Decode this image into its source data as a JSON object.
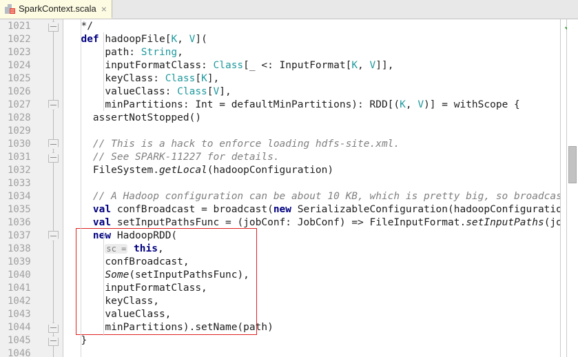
{
  "tab": {
    "title": "SparkContext.scala",
    "close_label": "×",
    "icon": "scala-file-icon"
  },
  "editor": {
    "first_line": 1021,
    "line_height": 19,
    "status_icon": "green-check-icon",
    "accent_highlight_color": "#e02020",
    "keyword_color": "#000080",
    "type_color": "#20999d",
    "comment_color": "#808080",
    "gutter_color": "#f0f0f0",
    "line_number_color": "#a0a0a0",
    "lines": [
      {
        "n": 1021,
        "indent": 4,
        "tokens": [
          {
            "t": "plain",
            "s": "  */"
          }
        ]
      },
      {
        "n": 1022,
        "indent": 0,
        "tokens": [
          {
            "t": "plain",
            "s": "  "
          },
          {
            "t": "kw",
            "s": "def"
          },
          {
            "t": "plain",
            "s": " hadoopFile["
          },
          {
            "t": "type",
            "s": "K"
          },
          {
            "t": "plain",
            "s": ", "
          },
          {
            "t": "type",
            "s": "V"
          },
          {
            "t": "plain",
            "s": "]("
          }
        ]
      },
      {
        "n": 1023,
        "indent": 0,
        "tokens": [
          {
            "t": "plain",
            "s": "      path: "
          },
          {
            "t": "type",
            "s": "String"
          },
          {
            "t": "plain",
            "s": ","
          }
        ]
      },
      {
        "n": 1024,
        "indent": 0,
        "tokens": [
          {
            "t": "plain",
            "s": "      inputFormatClass: "
          },
          {
            "t": "type",
            "s": "Class"
          },
          {
            "t": "plain",
            "s": "[_ <: InputFormat["
          },
          {
            "t": "type",
            "s": "K"
          },
          {
            "t": "plain",
            "s": ", "
          },
          {
            "t": "type",
            "s": "V"
          },
          {
            "t": "plain",
            "s": "]],"
          }
        ]
      },
      {
        "n": 1025,
        "indent": 0,
        "tokens": [
          {
            "t": "plain",
            "s": "      keyClass: "
          },
          {
            "t": "type",
            "s": "Class"
          },
          {
            "t": "plain",
            "s": "["
          },
          {
            "t": "type",
            "s": "K"
          },
          {
            "t": "plain",
            "s": "],"
          }
        ]
      },
      {
        "n": 1026,
        "indent": 0,
        "tokens": [
          {
            "t": "plain",
            "s": "      valueClass: "
          },
          {
            "t": "type",
            "s": "Class"
          },
          {
            "t": "plain",
            "s": "["
          },
          {
            "t": "type",
            "s": "V"
          },
          {
            "t": "plain",
            "s": "],"
          }
        ]
      },
      {
        "n": 1027,
        "indent": 0,
        "tokens": [
          {
            "t": "plain",
            "s": "      minPartitions: Int = defaultMinPartitions): RDD[("
          },
          {
            "t": "type",
            "s": "K"
          },
          {
            "t": "plain",
            "s": ", "
          },
          {
            "t": "type",
            "s": "V"
          },
          {
            "t": "plain",
            "s": ")] = withScope {"
          }
        ]
      },
      {
        "n": 1028,
        "indent": 0,
        "tokens": [
          {
            "t": "plain",
            "s": "    assertNotStopped()"
          }
        ]
      },
      {
        "n": 1029,
        "indent": 0,
        "tokens": []
      },
      {
        "n": 1030,
        "indent": 0,
        "tokens": [
          {
            "t": "plain",
            "s": "    "
          },
          {
            "t": "cmt",
            "s": "// This is a hack to enforce loading hdfs-site.xml."
          }
        ]
      },
      {
        "n": 1031,
        "indent": 0,
        "tokens": [
          {
            "t": "plain",
            "s": "    "
          },
          {
            "t": "cmt",
            "s": "// See SPARK-11227 for details."
          }
        ]
      },
      {
        "n": 1032,
        "indent": 0,
        "tokens": [
          {
            "t": "plain",
            "s": "    FileSystem."
          },
          {
            "t": "ital",
            "s": "getLocal"
          },
          {
            "t": "plain",
            "s": "(hadoopConfiguration)"
          }
        ]
      },
      {
        "n": 1033,
        "indent": 0,
        "tokens": []
      },
      {
        "n": 1034,
        "indent": 0,
        "tokens": [
          {
            "t": "plain",
            "s": "    "
          },
          {
            "t": "cmt",
            "s": "// A Hadoop configuration can be about 10 KB, which is pretty big, so broadcast it."
          }
        ]
      },
      {
        "n": 1035,
        "indent": 0,
        "tokens": [
          {
            "t": "plain",
            "s": "    "
          },
          {
            "t": "kw",
            "s": "val"
          },
          {
            "t": "plain",
            "s": " confBroadcast = broadcast("
          },
          {
            "t": "kw",
            "s": "new"
          },
          {
            "t": "plain",
            "s": " SerializableConfiguration(hadoopConfiguration))"
          }
        ]
      },
      {
        "n": 1036,
        "indent": 0,
        "tokens": [
          {
            "t": "plain",
            "s": "    "
          },
          {
            "t": "kw",
            "s": "val"
          },
          {
            "t": "plain",
            "s": " setInputPathsFunc = (jobConf: JobConf) => FileInputFormat."
          },
          {
            "t": "ital",
            "s": "setInputPaths"
          },
          {
            "t": "plain",
            "s": "(jobConf, path)"
          }
        ]
      },
      {
        "n": 1037,
        "indent": 0,
        "tokens": [
          {
            "t": "plain",
            "s": "    "
          },
          {
            "t": "kw",
            "s": "new"
          },
          {
            "t": "plain",
            "s": " HadoopRDD("
          }
        ]
      },
      {
        "n": 1038,
        "indent": 0,
        "tokens": [
          {
            "t": "plain",
            "s": "      "
          },
          {
            "t": "hint",
            "s": "sc ="
          },
          {
            "t": "plain",
            "s": " "
          },
          {
            "t": "kw",
            "s": "this"
          },
          {
            "t": "plain",
            "s": ","
          }
        ]
      },
      {
        "n": 1039,
        "indent": 0,
        "tokens": [
          {
            "t": "plain",
            "s": "      confBroadcast,"
          }
        ]
      },
      {
        "n": 1040,
        "indent": 0,
        "tokens": [
          {
            "t": "plain",
            "s": "      "
          },
          {
            "t": "ital",
            "s": "Some"
          },
          {
            "t": "plain",
            "s": "(setInputPathsFunc),"
          }
        ]
      },
      {
        "n": 1041,
        "indent": 0,
        "tokens": [
          {
            "t": "plain",
            "s": "      inputFormatClass,"
          }
        ]
      },
      {
        "n": 1042,
        "indent": 0,
        "tokens": [
          {
            "t": "plain",
            "s": "      keyClass,"
          }
        ]
      },
      {
        "n": 1043,
        "indent": 0,
        "tokens": [
          {
            "t": "plain",
            "s": "      valueClass,"
          }
        ]
      },
      {
        "n": 1044,
        "indent": 0,
        "tokens": [
          {
            "t": "plain",
            "s": "      minPartitions).setName(path)"
          }
        ]
      },
      {
        "n": 1045,
        "indent": 0,
        "tokens": [
          {
            "t": "plain",
            "s": "  }"
          }
        ]
      },
      {
        "n": 1046,
        "indent": 0,
        "tokens": []
      }
    ]
  }
}
